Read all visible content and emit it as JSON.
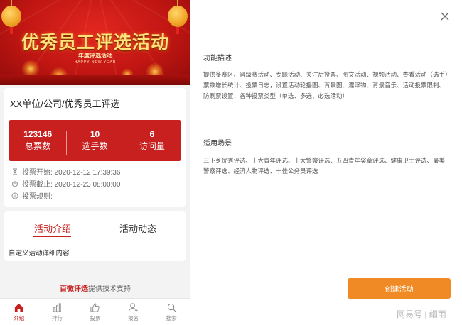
{
  "banner": {
    "title": "优秀员工评选活动",
    "subtitle": "年度评选活动",
    "subtitle_en": "HAPPY NEW YEAR"
  },
  "activity": {
    "title": "XX单位/公司/优秀员工评选",
    "stats": [
      {
        "value": "123146",
        "label": "总票数"
      },
      {
        "value": "10",
        "label": "选手数"
      },
      {
        "value": "6",
        "label": "访问量"
      }
    ],
    "info": [
      {
        "icon": "hourglass-icon",
        "text": "投票开始: 2020-12-12 17:39:36"
      },
      {
        "icon": "power-icon",
        "text": "投票截止: 2020-12-23 08:00:00"
      },
      {
        "icon": "info-icon",
        "text": "投票规则:"
      }
    ]
  },
  "tabs": {
    "intro": "活动介绍",
    "news": "活动动态",
    "intro_content": "自定义活动详细内容"
  },
  "support": {
    "brand": "百微评选",
    "text": "提供技术支持"
  },
  "tabbar": [
    {
      "label": "介绍",
      "icon": "home-icon",
      "active": true
    },
    {
      "label": "排行",
      "icon": "bar-chart-icon",
      "active": false
    },
    {
      "label": "投票",
      "icon": "thumbs-up-icon",
      "active": false
    },
    {
      "label": "报名",
      "icon": "user-add-icon",
      "active": false
    },
    {
      "label": "搜索",
      "icon": "search-icon",
      "active": false
    }
  ],
  "right_panel": {
    "features_title": "功能描述",
    "features_text": "提供多赛区、晋级赛活动、专题活动、关注后投票、图文活动、视频活动、查看活动（选手）票数增长统计、投票日志，设置活动轮播图、背景图、漂浮物、背景音乐、活动投票限制、防刷票设置、各种投票类型（单选、多选、必选活动）",
    "scenes_title": "适用场景",
    "scenes_text": "三下乡优秀评选、十大青年评选、十大警察评选、五四青年奖章评选、健康卫士评选、最美警察评选、经济人物评选、十佳公务员评选",
    "create_button": "创建活动",
    "watermark": "网易号 | 细雨"
  },
  "colors": {
    "primary_red": "#c8201f",
    "accent_orange": "#f08a24"
  }
}
